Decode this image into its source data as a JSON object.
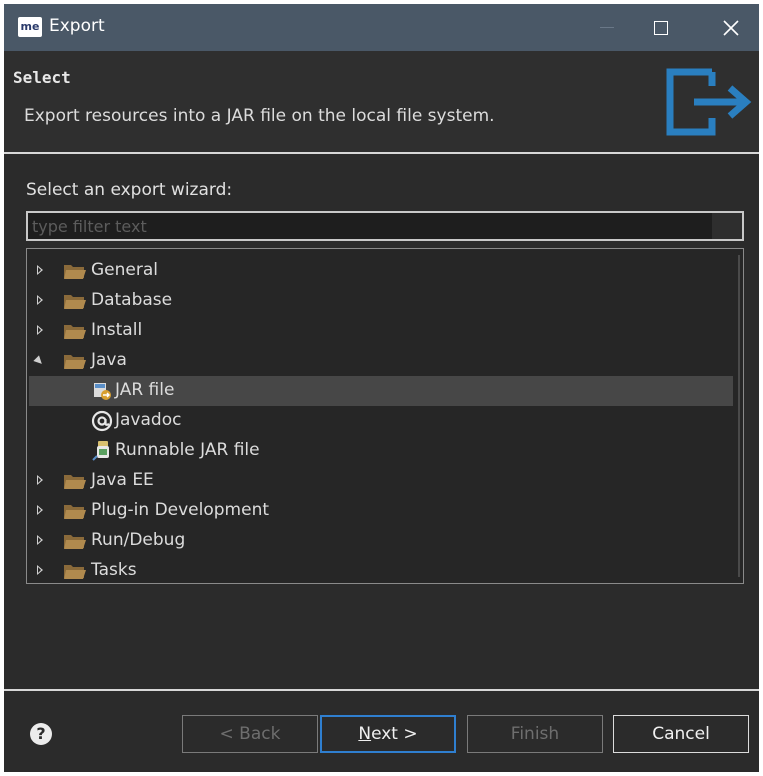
{
  "window": {
    "app_logo": "me",
    "title": "Export"
  },
  "header": {
    "title": "Select",
    "description": "Export resources into a JAR file on the local file system.",
    "icon": "export-icon"
  },
  "wizard": {
    "prompt": "Select an export wizard:",
    "filter_placeholder": "type filter text",
    "filter_value": ""
  },
  "tree": [
    {
      "label": "General",
      "type": "folder",
      "state": "collapsed"
    },
    {
      "label": "Database",
      "type": "folder",
      "state": "collapsed"
    },
    {
      "label": "Install",
      "type": "folder",
      "state": "collapsed"
    },
    {
      "label": "Java",
      "type": "folder",
      "state": "expanded"
    },
    {
      "label": "JAR file",
      "type": "item",
      "icon": "jar-file-icon",
      "selected": true
    },
    {
      "label": "Javadoc",
      "type": "item",
      "icon": "javadoc-icon"
    },
    {
      "label": "Runnable JAR file",
      "type": "item",
      "icon": "runnable-jar-icon"
    },
    {
      "label": "Java EE",
      "type": "folder",
      "state": "collapsed"
    },
    {
      "label": "Plug-in Development",
      "type": "folder",
      "state": "collapsed"
    },
    {
      "label": "Run/Debug",
      "type": "folder",
      "state": "collapsed"
    },
    {
      "label": "Tasks",
      "type": "folder",
      "state": "collapsed"
    }
  ],
  "footer": {
    "help_icon": "?",
    "back_label": "< Back",
    "next_mnemonic": "N",
    "next_rest": "ext >",
    "finish_label": "Finish",
    "cancel_label": "Cancel"
  },
  "colors": {
    "titlebar": "#4a5867",
    "background": "#2b2b2b",
    "accent": "#2f7fd0",
    "selection": "#474747"
  }
}
